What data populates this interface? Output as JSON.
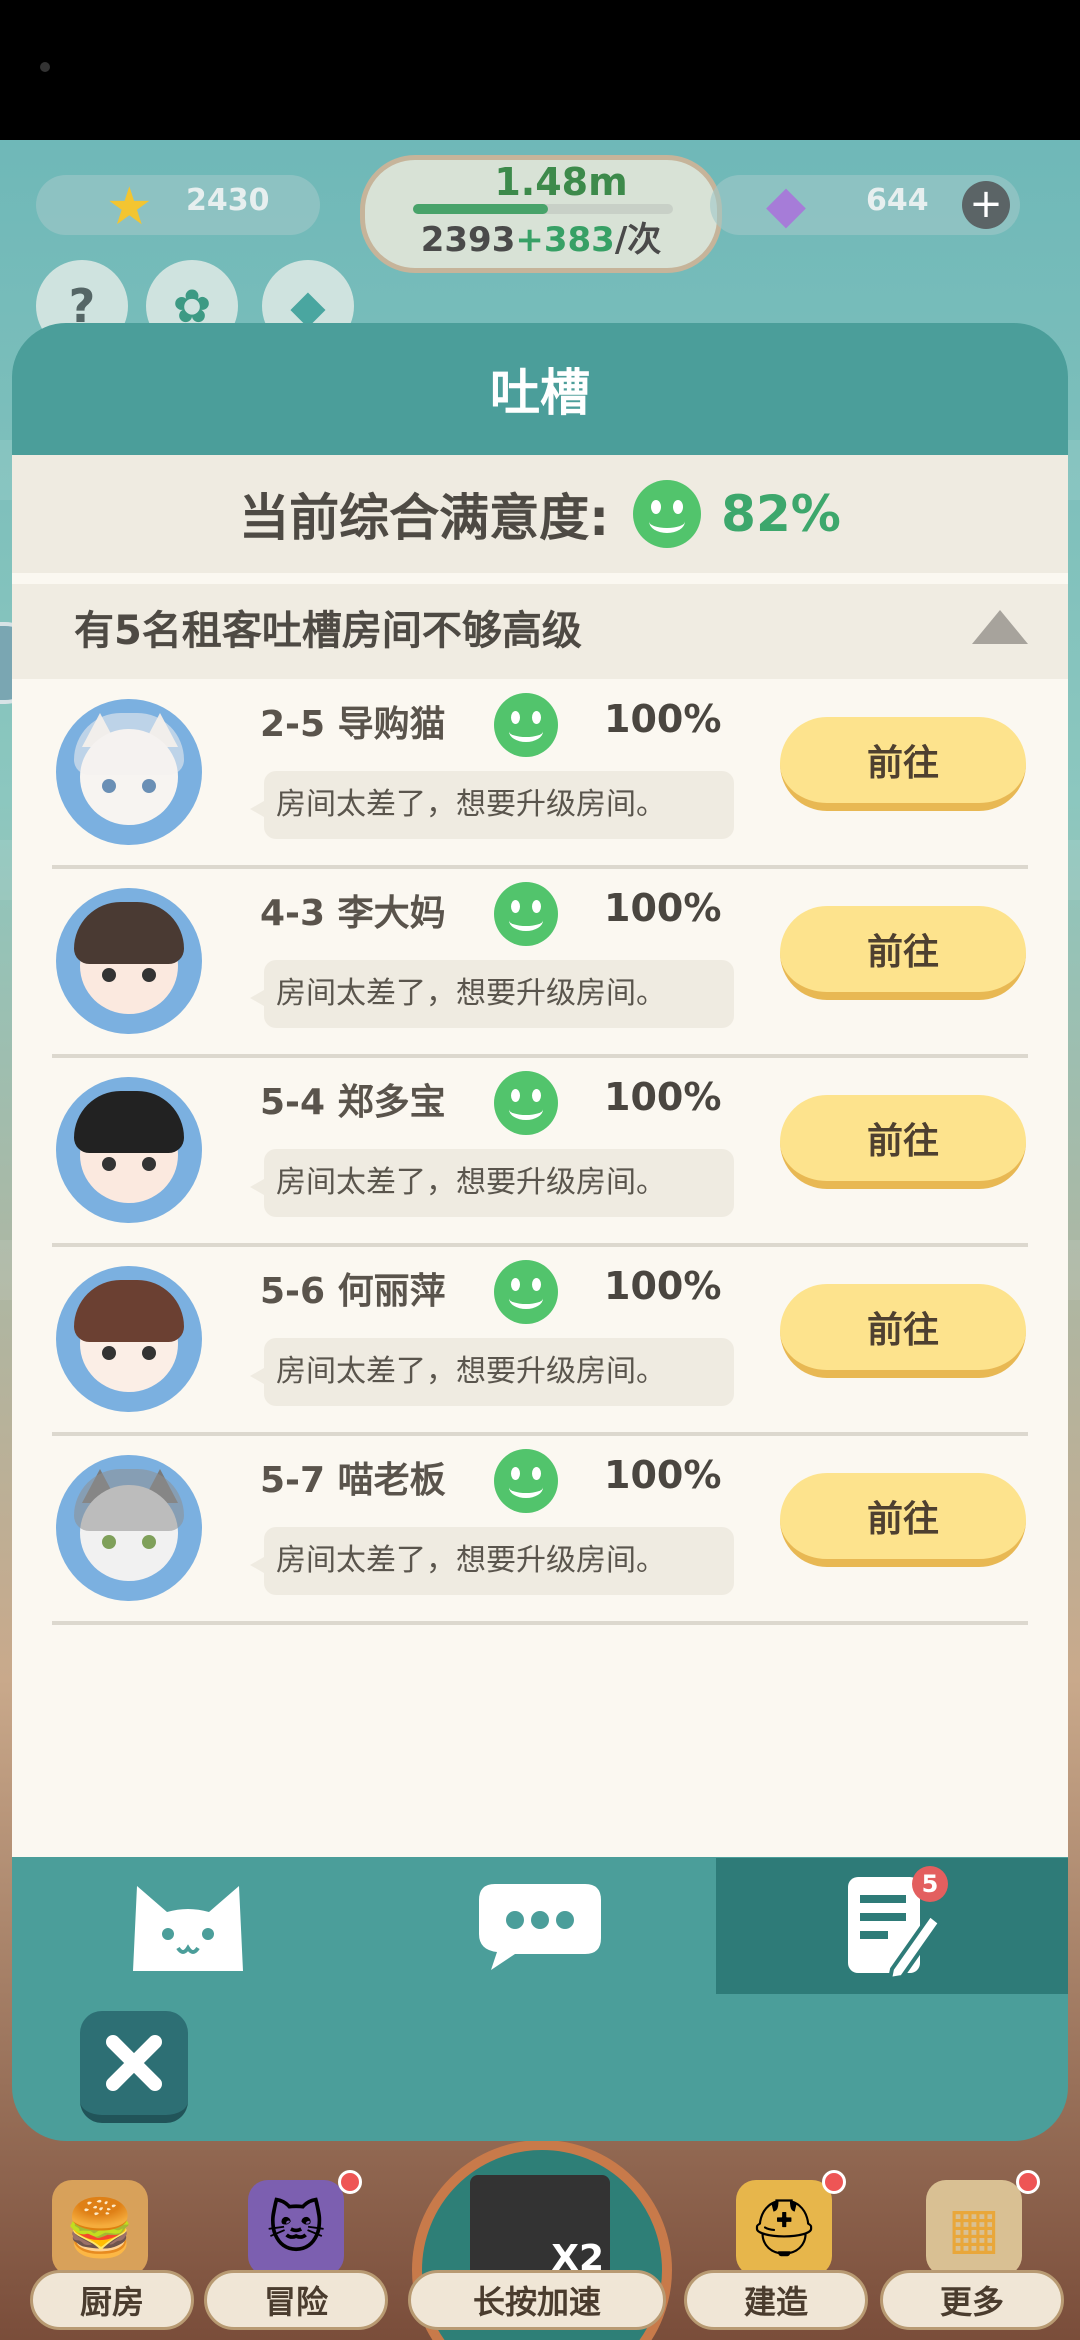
{
  "hud": {
    "stars": "2430",
    "gems": "644",
    "money": "1.48m",
    "money_progress": 0.52,
    "rate_base": "2393",
    "rate_bonus": "+383",
    "rate_unit": "/次"
  },
  "modal": {
    "title": "吐槽",
    "satisfaction_label": "当前综合满意度:",
    "satisfaction_value": "82%",
    "group_title": "有5名租客吐槽房间不够高级",
    "tenants": [
      {
        "name": "2-5  导购猫",
        "satisfaction": "100%",
        "complaint": "房间太差了，想要升级房间。",
        "button": "前往"
      },
      {
        "name": "4-3  李大妈",
        "satisfaction": "100%",
        "complaint": "房间太差了，想要升级房间。",
        "button": "前往"
      },
      {
        "name": "5-4  郑多宝",
        "satisfaction": "100%",
        "complaint": "房间太差了，想要升级房间。",
        "button": "前往"
      },
      {
        "name": "5-6  何丽萍",
        "satisfaction": "100%",
        "complaint": "房间太差了，想要升级房间。",
        "button": "前往"
      },
      {
        "name": "5-7  喵老板",
        "satisfaction": "100%",
        "complaint": "房间太差了，想要升级房间。",
        "button": "前往"
      }
    ],
    "tabs": [
      {
        "icon": "cat-icon"
      },
      {
        "icon": "chat-bubble-icon"
      },
      {
        "icon": "notepad-icon",
        "badge": "5"
      }
    ]
  },
  "bottom_nav": {
    "kitchen": "厨房",
    "adventure": "冒险",
    "speed": "长按加速",
    "speed_badge": "X2",
    "build": "建造",
    "more": "更多"
  },
  "colors": {
    "teal": "#4b9e9a",
    "teal_dark": "#2e7b78",
    "button_yellow": "#fde38d",
    "smile_green": "#52c46c"
  }
}
